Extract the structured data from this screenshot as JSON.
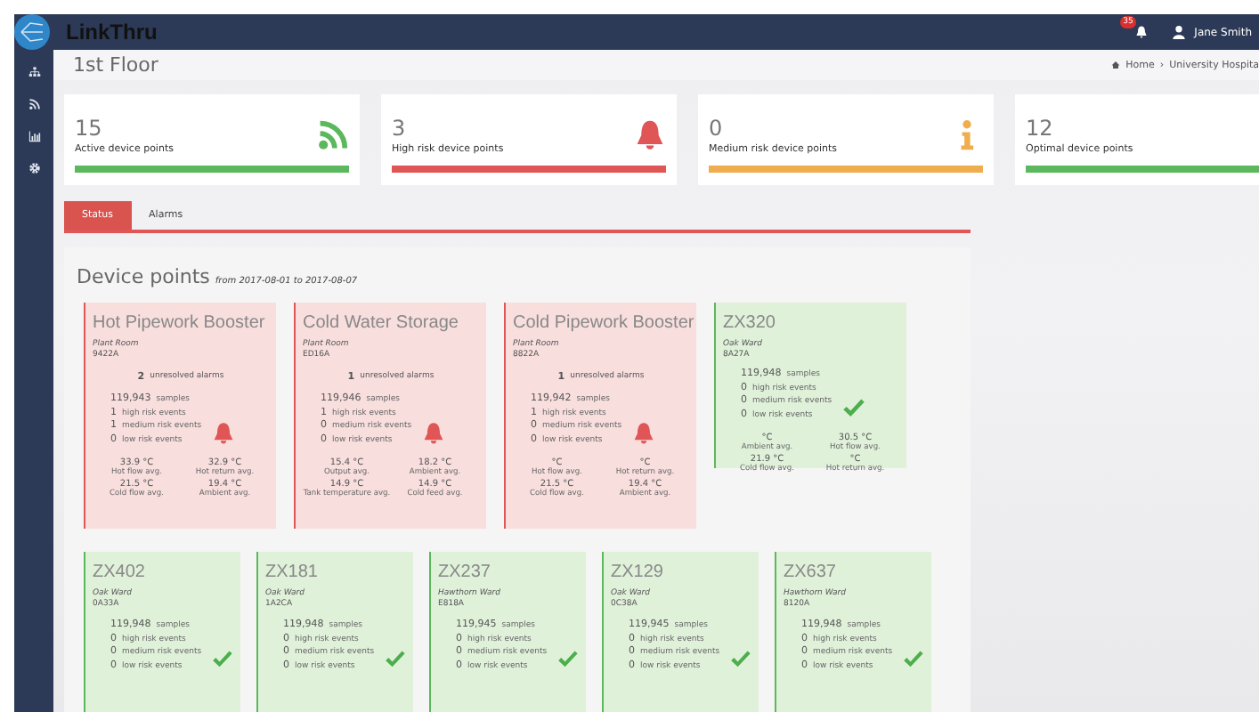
{
  "topbar": {
    "app_name": "LinkThru",
    "notification_count": "35",
    "user": "Jane Smith"
  },
  "sidebar": {
    "items": [
      {
        "kind": "sitemap"
      },
      {
        "kind": "feed"
      },
      {
        "kind": "chart"
      },
      {
        "kind": "gear"
      }
    ]
  },
  "page": {
    "title": "1st Floor",
    "breadcrumb": [
      "Home",
      "University Hospita"
    ],
    "breadcrumb_separator": "›"
  },
  "stats": [
    {
      "kind": "active",
      "value": "15",
      "label": "Active device points"
    },
    {
      "kind": "high",
      "value": "3",
      "label": "High risk device points"
    },
    {
      "kind": "medium",
      "value": "0",
      "label": "Medium risk device points"
    },
    {
      "kind": "optimal",
      "value": "12",
      "label": "Optimal device points"
    }
  ],
  "tabs": [
    {
      "label": "Status",
      "selected": true
    },
    {
      "label": "Alarms",
      "selected": false
    }
  ],
  "device_points": {
    "title": "Device points",
    "range": "from 2017-08-01 to 2017-08-07",
    "rows": [
      {
        "cards": [
          {
            "alert": true,
            "name": "Hot Pipework Booster",
            "location": "Plant Room",
            "code": "9422A",
            "alarms": "2",
            "alarms_label": "unresolved alarms",
            "stats": [
              {
                "count": "119,943",
                "label": "samples"
              },
              {
                "count": "1",
                "label": "high risk events"
              },
              {
                "count": "1",
                "label": "medium risk events"
              },
              {
                "count": "0",
                "label": "low risk events"
              }
            ],
            "readings": [
              {
                "value": "33.9 °C",
                "label": "Hot flow avg."
              },
              {
                "value": "32.9 °C",
                "label": "Hot return avg."
              },
              {
                "value": "21.5 °C",
                "label": "Cold flow avg."
              },
              {
                "value": "19.4 °C",
                "label": "Ambient avg."
              }
            ]
          },
          {
            "alert": true,
            "name": "Cold Water Storage",
            "location": "Plant Room",
            "code": "ED16A",
            "alarms": "1",
            "alarms_label": "unresolved alarms",
            "stats": [
              {
                "count": "119,946",
                "label": "samples"
              },
              {
                "count": "1",
                "label": "high risk events"
              },
              {
                "count": "0",
                "label": "medium risk events"
              },
              {
                "count": "0",
                "label": "low risk events"
              }
            ],
            "readings": [
              {
                "value": "15.4 °C",
                "label": "Output avg."
              },
              {
                "value": "18.2 °C",
                "label": "Ambient avg."
              },
              {
                "value": "14.9 °C",
                "label": "Tank temperature avg."
              },
              {
                "value": "14.9 °C",
                "label": "Cold feed avg."
              }
            ]
          },
          {
            "alert": true,
            "name": "Cold Pipework Booster",
            "location": "Plant Room",
            "code": "8822A",
            "alarms": "1",
            "alarms_label": "unresolved alarms",
            "stats": [
              {
                "count": "119,942",
                "label": "samples"
              },
              {
                "count": "1",
                "label": "high risk events"
              },
              {
                "count": "0",
                "label": "medium risk events"
              },
              {
                "count": "0",
                "label": "low risk events"
              }
            ],
            "readings": [
              {
                "value": "°C",
                "label": "Hot flow avg."
              },
              {
                "value": "°C",
                "label": "Hot return avg."
              },
              {
                "value": "21.5 °C",
                "label": "Cold flow avg."
              },
              {
                "value": "19.4 °C",
                "label": "Ambient avg."
              }
            ]
          },
          {
            "alert": false,
            "name": "ZX320",
            "location": "Oak Ward",
            "code": "8A27A",
            "stats": [
              {
                "count": "119,948",
                "label": "samples"
              },
              {
                "count": "0",
                "label": "high risk events"
              },
              {
                "count": "0",
                "label": "medium risk events"
              },
              {
                "count": "0",
                "label": "low risk events"
              }
            ],
            "readings": [
              {
                "value": "°C",
                "label": "Ambient avg."
              },
              {
                "value": "30.5 °C",
                "label": "Hot flow avg."
              },
              {
                "value": "21.9 °C",
                "label": "Cold flow avg."
              },
              {
                "value": "°C",
                "label": "Hot return avg."
              }
            ]
          }
        ]
      },
      {
        "cards": [
          {
            "alert": false,
            "name": "ZX402",
            "location": "Oak Ward",
            "code": "0A33A",
            "stats": [
              {
                "count": "119,948",
                "label": "samples"
              },
              {
                "count": "0",
                "label": "high risk events"
              },
              {
                "count": "0",
                "label": "medium risk events"
              },
              {
                "count": "0",
                "label": "low risk events"
              }
            ]
          },
          {
            "alert": false,
            "name": "ZX181",
            "location": "Oak Ward",
            "code": "1A2CA",
            "stats": [
              {
                "count": "119,948",
                "label": "samples"
              },
              {
                "count": "0",
                "label": "high risk events"
              },
              {
                "count": "0",
                "label": "medium risk events"
              },
              {
                "count": "0",
                "label": "low risk events"
              }
            ]
          },
          {
            "alert": false,
            "name": "ZX237",
            "location": "Hawthorn Ward",
            "code": "E818A",
            "stats": [
              {
                "count": "119,945",
                "label": "samples"
              },
              {
                "count": "0",
                "label": "high risk events"
              },
              {
                "count": "0",
                "label": "medium risk events"
              },
              {
                "count": "0",
                "label": "low risk events"
              }
            ]
          },
          {
            "alert": false,
            "name": "ZX129",
            "location": "Oak Ward",
            "code": "0C38A",
            "stats": [
              {
                "count": "119,945",
                "label": "samples"
              },
              {
                "count": "0",
                "label": "high risk events"
              },
              {
                "count": "0",
                "label": "medium risk events"
              },
              {
                "count": "0",
                "label": "low risk events"
              }
            ]
          },
          {
            "alert": false,
            "name": "ZX637",
            "location": "Hawthorn Ward",
            "code": "8120A",
            "stats": [
              {
                "count": "119,948",
                "label": "samples"
              },
              {
                "count": "0",
                "label": "high risk events"
              },
              {
                "count": "0",
                "label": "medium risk events"
              },
              {
                "count": "0",
                "label": "low risk events"
              }
            ]
          }
        ]
      }
    ]
  }
}
